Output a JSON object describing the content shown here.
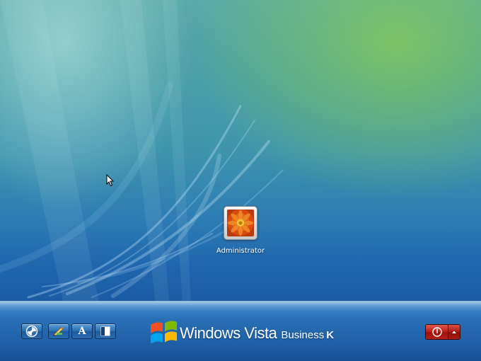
{
  "user": {
    "name": "Administrator"
  },
  "toolbar": {
    "ease_of_access_icon": "ease-of-access-icon",
    "language_icon": "pen-icon",
    "font_icon_letter": "A",
    "contrast_icon": "contrast-icon"
  },
  "branding": {
    "product": "Windows Vista",
    "edition": "Business",
    "sku": "K",
    "logo_icon": "windows-flag-icon"
  },
  "power": {
    "icon": "power-icon",
    "menu_icon": "chevron-up-icon"
  },
  "colors": {
    "accent_blue": "#2a6fb5",
    "power_red": "#b81d14",
    "green_glow": "#82c85a"
  }
}
